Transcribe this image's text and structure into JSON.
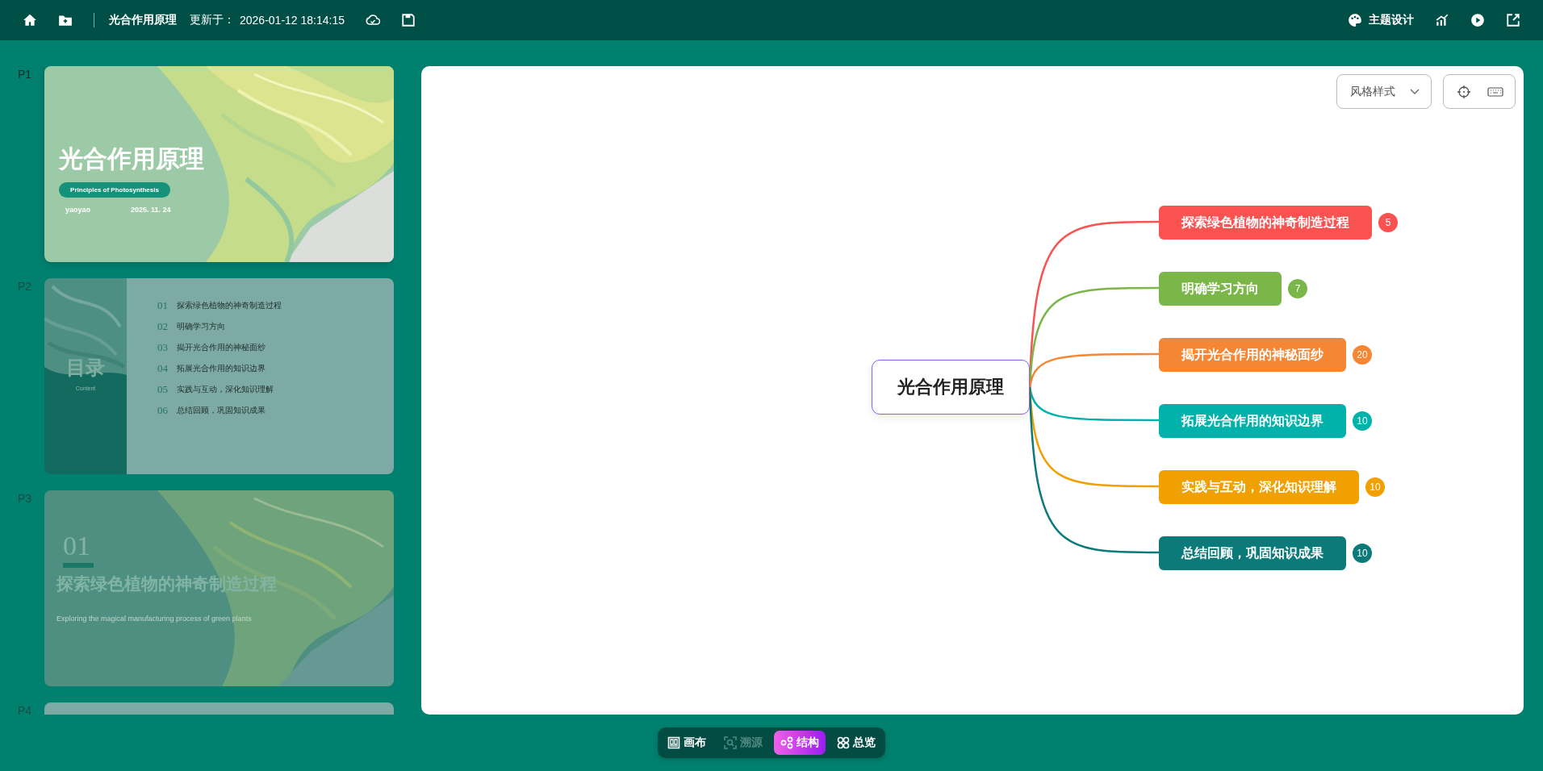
{
  "topbar": {
    "title": "光合作用原理",
    "updated_label": "更新于：",
    "updated_time": "2026-01-12 18:14:15",
    "theme_button": "主题设计"
  },
  "slides": [
    {
      "label": "P1",
      "kind": "cover",
      "selected": true,
      "title": "光合作用原理",
      "subtitle": "Principles of Photosynthesis",
      "author": "yaoyao",
      "date": "2025. 11. 24"
    },
    {
      "label": "P2",
      "kind": "toc",
      "selected": false,
      "title": "目录",
      "subtitle": "Content",
      "items": [
        {
          "number": "01",
          "text": "探索绿色植物的神奇制造过程"
        },
        {
          "number": "02",
          "text": "明确学习方向"
        },
        {
          "number": "03",
          "text": "揭开光合作用的神秘面纱"
        },
        {
          "number": "04",
          "text": "拓展光合作用的知识边界"
        },
        {
          "number": "05",
          "text": "实践与互动，深化知识理解"
        },
        {
          "number": "06",
          "text": "总结回顾，巩固知识成果"
        }
      ]
    },
    {
      "label": "P3",
      "kind": "section",
      "selected": false,
      "number": "01",
      "title": "探索绿色植物的神奇制造过程",
      "subtitle": "Exploring the magical manufacturing process of green plants"
    },
    {
      "label": "P4",
      "kind": "blank",
      "selected": false
    }
  ],
  "style_dropdown": "风格样式",
  "mindmap": {
    "root": "光合作用原理",
    "branches": [
      {
        "label": "探索绿色植物的神奇制造过程",
        "count": "5",
        "color": "#fa5151"
      },
      {
        "label": "明确学习方向",
        "count": "7",
        "color": "#7ab648"
      },
      {
        "label": "揭开光合作用的神秘面纱",
        "count": "20",
        "color": "#f58634"
      },
      {
        "label": "拓展光合作用的知识边界",
        "count": "10",
        "color": "#00b2a9"
      },
      {
        "label": "实践与互动，深化知识理解",
        "count": "10",
        "color": "#f0a000"
      },
      {
        "label": "总结回顾，巩固知识成果",
        "count": "10",
        "color": "#0d7a7a"
      }
    ]
  },
  "view_tabs": [
    {
      "label": "画布",
      "kind": "canvas",
      "selected": false,
      "disabled": false
    },
    {
      "label": "溯源",
      "kind": "trace",
      "selected": false,
      "disabled": true
    },
    {
      "label": "结构",
      "kind": "structure",
      "selected": true,
      "disabled": false
    },
    {
      "label": "总览",
      "kind": "overview",
      "selected": false,
      "disabled": false
    }
  ]
}
